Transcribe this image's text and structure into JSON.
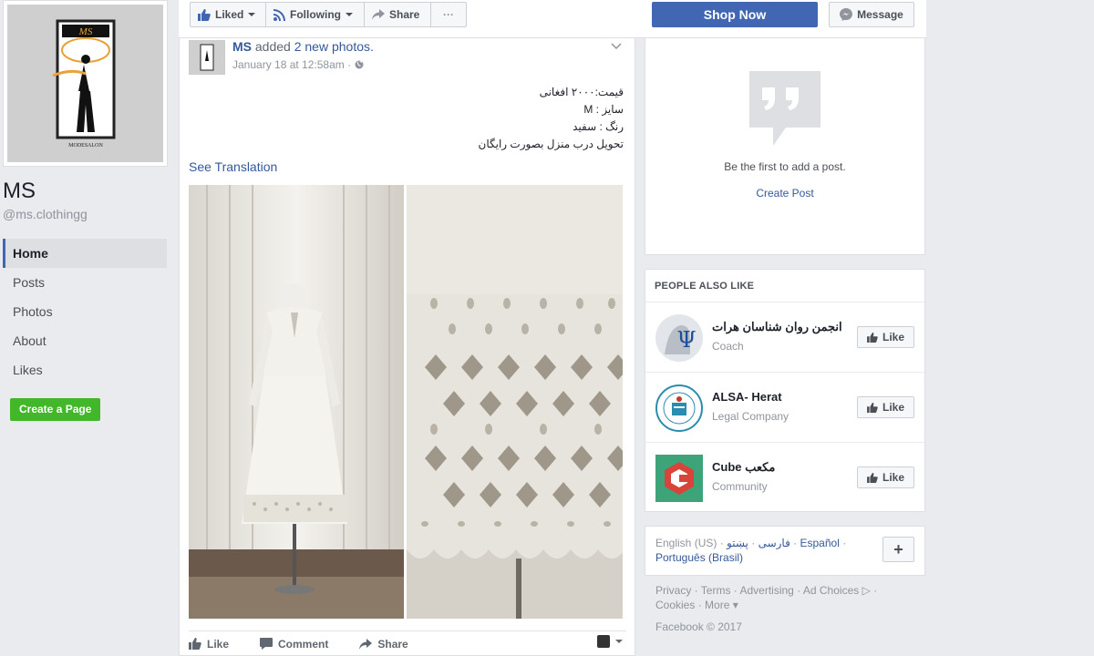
{
  "page": {
    "name": "MS",
    "handle": "@ms.clothingg",
    "profile_logo_text": "MS",
    "profile_logo_subtext": "MODESALON"
  },
  "left_nav": {
    "items": [
      {
        "label": "Home",
        "active": true
      },
      {
        "label": "Posts"
      },
      {
        "label": "Photos"
      },
      {
        "label": "About"
      },
      {
        "label": "Likes"
      }
    ],
    "create_page_label": "Create a Page"
  },
  "topbar": {
    "liked_label": "Liked",
    "following_label": "Following",
    "share_label": "Share",
    "more_label": "···",
    "shop_label": "Shop Now",
    "message_label": "Message"
  },
  "post": {
    "author": "MS",
    "action_text": "added",
    "photos_link": "2 new photos.",
    "time": "January 18 at 12:58am ·",
    "text_lines": [
      "قیمت:۲۰۰۰ افغانی",
      "سایز : M",
      "رنگ : سفید",
      "تحویل درب منزل بصورت رایگان"
    ],
    "see_translation": "See Translation",
    "like_label": "Like",
    "comment_label": "Comment",
    "share_label": "Share"
  },
  "empty_card": {
    "text": "Be the first to add a post.",
    "link": "Create Post"
  },
  "people_also_like": {
    "title": "PEOPLE ALSO LIKE",
    "items": [
      {
        "name": "انجمن روان شناسان هرات",
        "category": "Coach",
        "like_label": "Like"
      },
      {
        "name": "ALSA- Herat",
        "category": "Legal Company",
        "like_label": "Like"
      },
      {
        "name": "Cube مکعب",
        "category": "Community",
        "like_label": "Like"
      }
    ]
  },
  "languages": {
    "current": "English (US)",
    "sep": " · ",
    "lang2": "فارسی",
    "lang3": "پښتو",
    "lang4": "Español",
    "lang5": "Português (Brasil)",
    "plus": "+"
  },
  "footer": {
    "privacy": "Privacy",
    "terms": "Terms",
    "advertising": "Advertising",
    "ad_choices": "Ad Choices",
    "cookies": "Cookies",
    "more": "More",
    "copyright": "Facebook © 2017"
  },
  "colors": {
    "brand": "#4267b2",
    "link": "#365899",
    "green": "#42b72a",
    "background": "#e9ebee"
  }
}
